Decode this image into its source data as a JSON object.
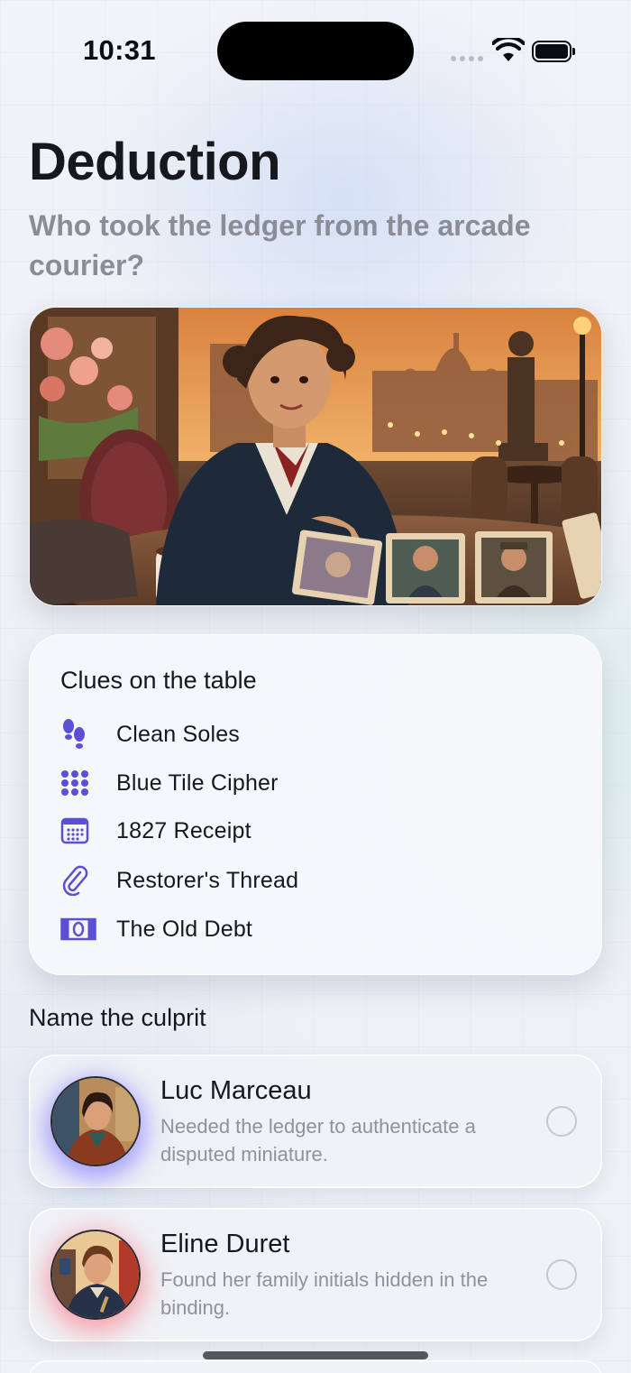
{
  "status_bar": {
    "time": "10:31"
  },
  "header": {
    "title": "Deduction",
    "subtitle": "Who took the ledger from the arcade courier?"
  },
  "clues_card": {
    "title": "Clues on the table",
    "accent_color": "#5b4fd6",
    "items": [
      {
        "icon": "footprints-icon",
        "label": "Clean Soles"
      },
      {
        "icon": "tile-grid-icon",
        "label": "Blue Tile Cipher"
      },
      {
        "icon": "calendar-icon",
        "label": "1827 Receipt"
      },
      {
        "icon": "paperclip-icon",
        "label": "Restorer's Thread"
      },
      {
        "icon": "banknote-icon",
        "label": "The Old Debt"
      }
    ]
  },
  "culprit_section": {
    "label": "Name the culprit",
    "suspects": [
      {
        "name": "Luc Marceau",
        "description": "Needed the ledger to authenticate a disputed miniature.",
        "glow_color": "#6a5cff",
        "selected": false
      },
      {
        "name": "Eline Duret",
        "description": "Found her family initials hidden in the binding.",
        "glow_color": "#ff5a6a",
        "selected": false
      }
    ]
  }
}
